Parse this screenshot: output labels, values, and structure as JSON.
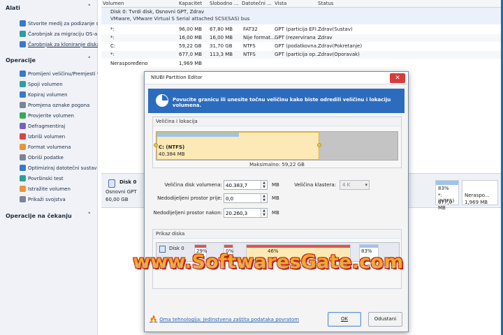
{
  "sidebar": {
    "sections": [
      {
        "title": "Alati",
        "items": [
          {
            "label": "Stvorite medij za podizanje s...",
            "icon": "media-icon"
          },
          {
            "label": "Čarobnjak za migraciju OS-a",
            "icon": "migrate-icon"
          },
          {
            "label": "Čarobnjak za kloniranje diska",
            "icon": "clone-icon"
          }
        ]
      },
      {
        "title": "Operacije",
        "items": [
          {
            "label": "Promijeni veličinu/Premjesti v...",
            "icon": "resize-icon"
          },
          {
            "label": "Spoji volumen",
            "icon": "merge-icon"
          },
          {
            "label": "Kopiraj volumen",
            "icon": "copy-icon"
          },
          {
            "label": "Promjena oznake pogona",
            "icon": "label-icon"
          },
          {
            "label": "Provjerite volumen",
            "icon": "check-icon"
          },
          {
            "label": "Defragmentiraj",
            "icon": "defrag-icon"
          },
          {
            "label": "Izbriši volumen",
            "icon": "delete-icon"
          },
          {
            "label": "Format volumena",
            "icon": "format-icon"
          },
          {
            "label": "Obriši podatke",
            "icon": "wipe-icon"
          },
          {
            "label": "Optimiziraj datotečni sustav",
            "icon": "optimize-icon"
          },
          {
            "label": "Površinski test",
            "icon": "surface-test-icon"
          },
          {
            "label": "Istražite volumen",
            "icon": "explore-icon"
          },
          {
            "label": "Prikaži svojstva",
            "icon": "properties-icon"
          }
        ]
      },
      {
        "title": "Operacije na čekanju",
        "items": []
      }
    ]
  },
  "table": {
    "headers": [
      "Volumen",
      "Kapacitet",
      "Slobodno ...",
      "Datotečni ...",
      "Vista",
      "Status"
    ],
    "disk": {
      "title": "Disk 0: Tvrdi disk, Osnovni GPT, Zdrav",
      "subtitle": "VMware, VMware Virtual S Serial attached SCSI(SAS) bus"
    },
    "rows": [
      [
        "*:",
        "96,00 MB",
        "67,80 MB",
        "FAT32",
        "GPT (particija EFI...",
        "Zdrav(Sustav)"
      ],
      [
        "*:",
        "16,00 MB",
        "16,00 MB",
        "Nije format...",
        "GPT (rezervirana ...",
        "Zdrav"
      ],
      [
        "C:",
        "59,22 GB",
        "31,70 GB",
        "NTFS",
        "GPT (podatkovna...",
        "Zdrav(Pokretanje)"
      ],
      [
        "*:",
        "677,0 MB",
        "113,3 MB",
        "NTFS",
        "GPT (particija op...",
        "Zdrav(Oporavak)"
      ],
      [
        "Neraspoređeno",
        "1,969 MB",
        "",
        "",
        "",
        ""
      ]
    ]
  },
  "diskmap": {
    "name": "Disk 0",
    "type": "Osnovni GPT",
    "size": "60,00 GB",
    "pct": "83%",
    "recovery_label": "*: (NTFS)",
    "recovery_size": "677,0 MB",
    "unalloc_label": "Neraspo...",
    "unalloc_size": "1,969 MB"
  },
  "dialog": {
    "title": "NIUBI Partition Editor",
    "close_glyph": "✕",
    "banner": "Povucite granicu ili unesite točnu veličinu kako biste odredili veličinu i lokaciju volumena.",
    "size_group_title": "Veličina i lokacija",
    "partition": {
      "name": "C: (NTFS)",
      "size": "40.384 MB",
      "fraction_of_disk": 0.674,
      "used_fraction": 0.5
    },
    "max_label": "Maksimalno: 59,22 GB",
    "fields": {
      "volume_size_label": "Veličina disk volumena:",
      "volume_size_value": "40.383,7",
      "before_label": "Nedodijeljeni prostor prije:",
      "before_value": "0,0",
      "after_label": "Nedodijeljeni prostor nakon:",
      "after_value": "20.260,3",
      "unit": "MB",
      "cluster_label": "Veličina klastera:",
      "cluster_value": "4 K"
    },
    "disk_view": {
      "title": "Prikaz diska",
      "disk_name": "Disk 0",
      "segments": [
        "29%",
        "0%",
        "46%",
        "83%"
      ]
    },
    "footer_link": "Oma tehnologija: Jedinstvena zaštita podataka povratom",
    "ok_label": "OK",
    "cancel_label": "Odustani"
  },
  "watermark": "www.SoftwaresGate.com",
  "colors": {
    "banner": "#2c6cbf",
    "partition": "#fde9b5",
    "watermark": "#f5a623",
    "close": "#d83b3b"
  }
}
